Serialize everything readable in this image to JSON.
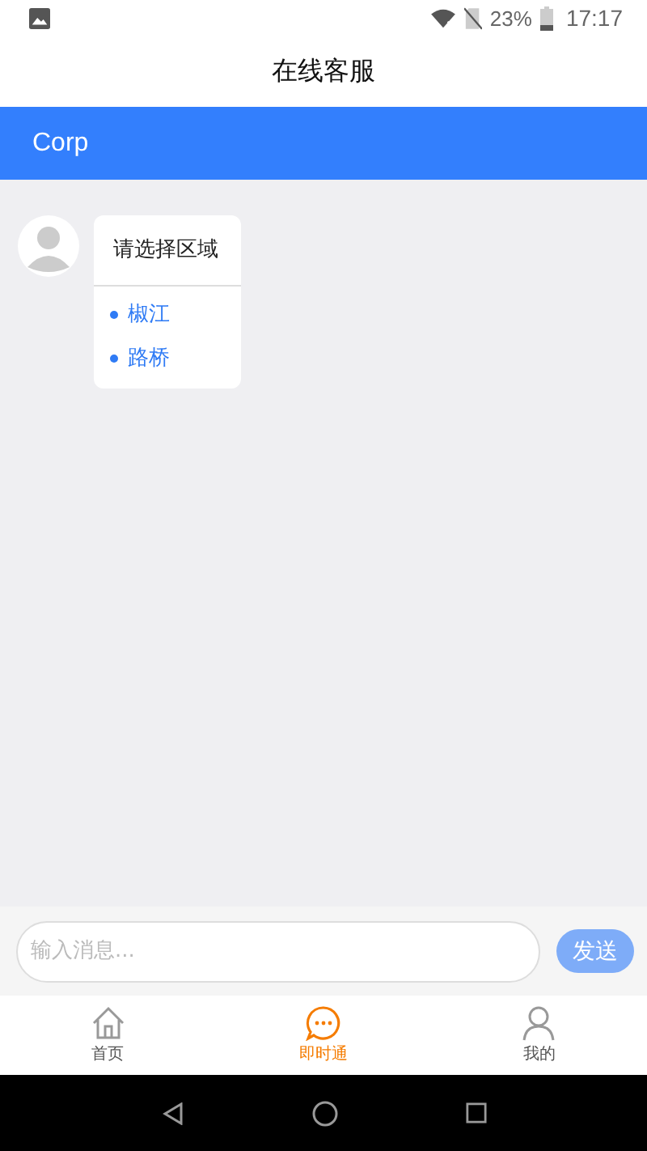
{
  "status_bar": {
    "battery": "23%",
    "time": "17:17"
  },
  "title": "在线客服",
  "header": {
    "title": "Corp"
  },
  "messages": [
    {
      "title": "请选择区域",
      "options": [
        "椒江",
        "路桥"
      ]
    }
  ],
  "composer": {
    "placeholder": "输入消息...",
    "send": "发送"
  },
  "tabs": [
    {
      "kind": "home",
      "label": "首页",
      "selected": false
    },
    {
      "kind": "chat",
      "label": "即时通",
      "selected": true
    },
    {
      "kind": "profile",
      "label": "我的",
      "selected": false
    }
  ]
}
